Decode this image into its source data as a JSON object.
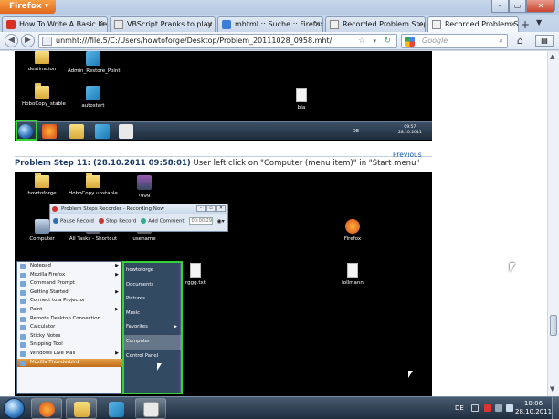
{
  "browser": {
    "menu_button": "Firefox",
    "tabs": [
      {
        "label": "How To Write A Basic Keyl..."
      },
      {
        "label": "VBScript Pranks to play on..."
      },
      {
        "label": "mhtml :: Suche :: Firefox A..."
      },
      {
        "label": "Recorded Problem Steps"
      },
      {
        "label": "Recorded Problem Steps",
        "active": true
      }
    ],
    "url": "unmht:///file.5/C:/Users/howtoforge/Desktop/Problem_20111028_0958.mht/",
    "search_placeholder": "Google"
  },
  "page": {
    "shot1_icons": [
      {
        "label": "destination",
        "kind": "folder"
      },
      {
        "label": "Admin_Restore_Point",
        "kind": "exe"
      },
      {
        "label": "HoboCopy_stable",
        "kind": "folder"
      },
      {
        "label": "autostart",
        "kind": "exe"
      },
      {
        "label": "bla",
        "kind": "file"
      }
    ],
    "shot1_clock": {
      "time": "09:57",
      "date": "28.10.2011"
    },
    "shot1_lang": "DE",
    "previous_link": "Previous",
    "step": {
      "heading": "Problem Step 11: (28.10.2011 09:58:01)",
      "text": "User left click on \"Computer (menu item)\" in \"Start menu\""
    },
    "shot2_icons": [
      {
        "label": "howtoforge",
        "kind": "folder"
      },
      {
        "label": "HoboCopy unstable",
        "kind": "folder"
      },
      {
        "label": "rggg",
        "kind": "exe"
      },
      {
        "label": "Computer",
        "kind": "exe"
      },
      {
        "label": "All Tasks - Shortcut",
        "kind": "exe"
      },
      {
        "label": "usename",
        "kind": "exe"
      },
      {
        "label": "Firefox",
        "kind": "exe"
      },
      {
        "label": "rggg.txt",
        "kind": "file"
      },
      {
        "label": "lollmann",
        "kind": "file"
      }
    ],
    "recorder": {
      "title": "Problem Steps Recorder - Recording Now",
      "pause": "Pause Record",
      "stop": "Stop Record",
      "add_comment": "Add Comment",
      "timer": "00:00:29"
    },
    "start_menu_left": [
      {
        "label": "Notepad",
        "sub": true
      },
      {
        "label": "Mozilla Firefox",
        "sub": true
      },
      {
        "label": "Command Prompt"
      },
      {
        "label": "Getting Started",
        "sub": true
      },
      {
        "label": "Connect to a Projector"
      },
      {
        "label": "Paint",
        "sub": true
      },
      {
        "label": "Remote Desktop Connection"
      },
      {
        "label": "Calculator"
      },
      {
        "label": "Sticky Notes"
      },
      {
        "label": "Snipping Tool"
      },
      {
        "label": "Windows Live Mail",
        "sub": true
      },
      {
        "label": "Mozilla Thunderbird",
        "hl": true
      }
    ],
    "start_menu_right": [
      {
        "label": "howtoforge"
      },
      {
        "label": "Documents"
      },
      {
        "label": "Pictures"
      },
      {
        "label": "Music"
      },
      {
        "label": "Favorites",
        "sub": true
      },
      {
        "label": "Computer",
        "hl": true
      },
      {
        "label": "Control Panel"
      }
    ]
  },
  "taskbar": {
    "lang": "DE",
    "time": "10:06",
    "date": "28.10.2011"
  },
  "colors": {
    "highlight_green": "#35d135",
    "link_blue": "#1a5fb4",
    "firefox_orange": "#e0661c"
  }
}
